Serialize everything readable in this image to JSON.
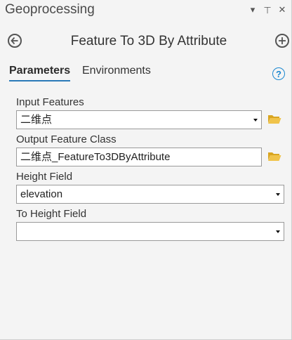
{
  "window": {
    "title": "Geoprocessing"
  },
  "titlebar_icons": {
    "dropdown": "▾",
    "pin": "⊥",
    "close": "✕"
  },
  "tool": {
    "title": "Feature To 3D By Attribute"
  },
  "tabs": {
    "parameters": "Parameters",
    "environments": "Environments"
  },
  "help": {
    "label": "?"
  },
  "fields": {
    "input_features": {
      "label": "Input Features",
      "value": "二维点"
    },
    "output_feature_class": {
      "label": "Output Feature Class",
      "value": "二维点_FeatureTo3DByAttribute"
    },
    "height_field": {
      "label": "Height Field",
      "value": "elevation"
    },
    "to_height_field": {
      "label": "To Height Field",
      "value": ""
    }
  },
  "colors": {
    "accent": "#2a7ab8",
    "help": "#1a87d0",
    "folder": "#e8b93c"
  }
}
